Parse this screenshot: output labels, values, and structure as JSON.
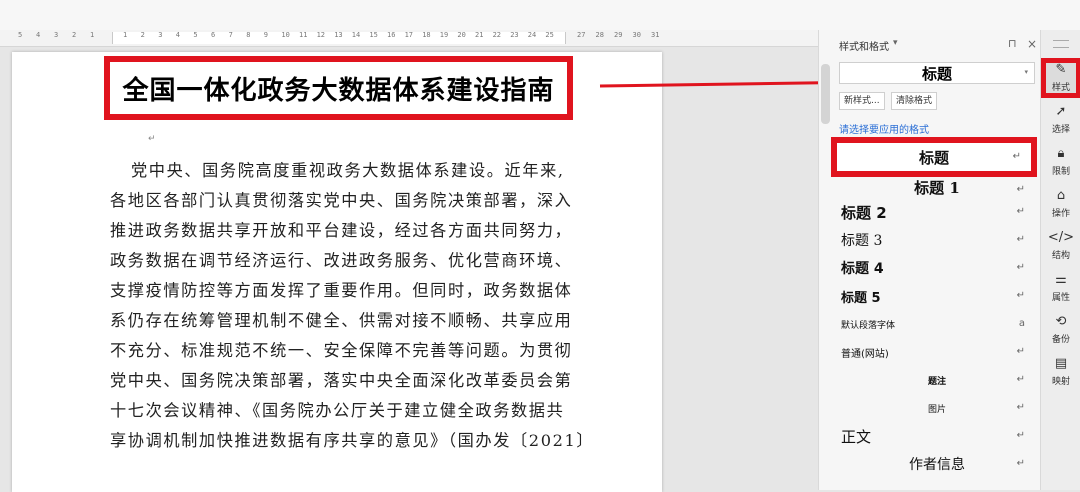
{
  "ruler": {
    "left_numbers": [
      "5",
      "4",
      "3",
      "2",
      "1"
    ],
    "numbers": [
      "1",
      "2",
      "3",
      "4",
      "5",
      "6",
      "7",
      "8",
      "9",
      "10",
      "11",
      "12",
      "13",
      "14",
      "15",
      "16",
      "17",
      "18",
      "19",
      "20",
      "21",
      "22",
      "23",
      "24",
      "25"
    ],
    "right_numbers": [
      "27",
      "28",
      "29",
      "30",
      "31"
    ]
  },
  "document": {
    "title": "全国一体化政务大数据体系建设指南",
    "paragraph_mark": "↵",
    "body_lines": [
      "党中央、国务院高度重视政务大数据体系建设。近年来,",
      "各地区各部门认真贯彻落实党中央、国务院决策部署，深入",
      "推进政务数据共享开放和平台建设，经过各方面共同努力，",
      "政务数据在调节经济运行、改进政务服务、优化营商环境、",
      "支撑疫情防控等方面发挥了重要作用。但同时，政务数据体",
      "系仍存在统筹管理机制不健全、供需对接不顺畅、共享应用",
      "不充分、标准规范不统一、安全保障不完善等问题。为贯彻",
      "党中央、国务院决策部署，落实中央全面深化改革委员会第",
      "十七次会议精神、《国务院办公厅关于建立健全政务数据共",
      "享协调机制加快推进数据有序共享的意见》（国办发〔2021〕"
    ]
  },
  "styles_panel": {
    "title": "样式和格式",
    "dropdown_glyph": "▾",
    "pin_glyph": "⊓",
    "close_glyph": "×",
    "current_style": "标题",
    "new_style_button": "新样式...",
    "clear_format_button": "清除格式",
    "hint": "请选择要应用的格式",
    "return_glyph": "↵",
    "items": [
      {
        "label": "标题",
        "kind": "title",
        "selected": true,
        "marker": "↵"
      },
      {
        "label": "标题 1",
        "kind": "h1",
        "selected": false,
        "marker": "↵"
      },
      {
        "label": "标题 2",
        "kind": "h2",
        "selected": false,
        "marker": "↵"
      },
      {
        "label": "标题 3",
        "kind": "h3",
        "selected": false,
        "marker": "↵"
      },
      {
        "label": "标题 4",
        "kind": "h4",
        "selected": false,
        "marker": "↵"
      },
      {
        "label": "标题 5",
        "kind": "h5",
        "selected": false,
        "marker": "↵"
      },
      {
        "label": "默认段落字体",
        "kind": "default-font",
        "selected": false,
        "marker": "a"
      },
      {
        "label": "普通(网站)",
        "kind": "normal-web",
        "selected": false,
        "marker": "↵"
      },
      {
        "label": "题注",
        "kind": "caption",
        "selected": false,
        "marker": "↵"
      },
      {
        "label": "图片",
        "kind": "picture",
        "selected": false,
        "marker": "↵"
      },
      {
        "label": "正文",
        "kind": "body",
        "selected": false,
        "marker": "↵"
      },
      {
        "label": "作者信息",
        "kind": "author",
        "selected": false,
        "marker": "↵"
      }
    ]
  },
  "side_toolbar": {
    "tools": [
      {
        "label": "样式",
        "icon": "pencil-icon",
        "glyph": "✎",
        "active": true
      },
      {
        "label": "选择",
        "icon": "cursor-icon",
        "glyph": "➚",
        "active": false
      },
      {
        "label": "限制",
        "icon": "lock-icon",
        "glyph": "🔒︎",
        "active": false
      },
      {
        "label": "操作",
        "icon": "tag-icon",
        "glyph": "⌂",
        "active": false
      },
      {
        "label": "结构",
        "icon": "code-icon",
        "glyph": "</>",
        "active": false
      },
      {
        "label": "属性",
        "icon": "sliders-icon",
        "glyph": "⚌",
        "active": false
      },
      {
        "label": "备份",
        "icon": "history-icon",
        "glyph": "⟲",
        "active": false
      },
      {
        "label": "映射",
        "icon": "map-icon",
        "glyph": "▤",
        "active": false
      }
    ]
  },
  "colors": {
    "highlight_red": "#e0141e",
    "hint_blue": "#2b6fd6"
  }
}
